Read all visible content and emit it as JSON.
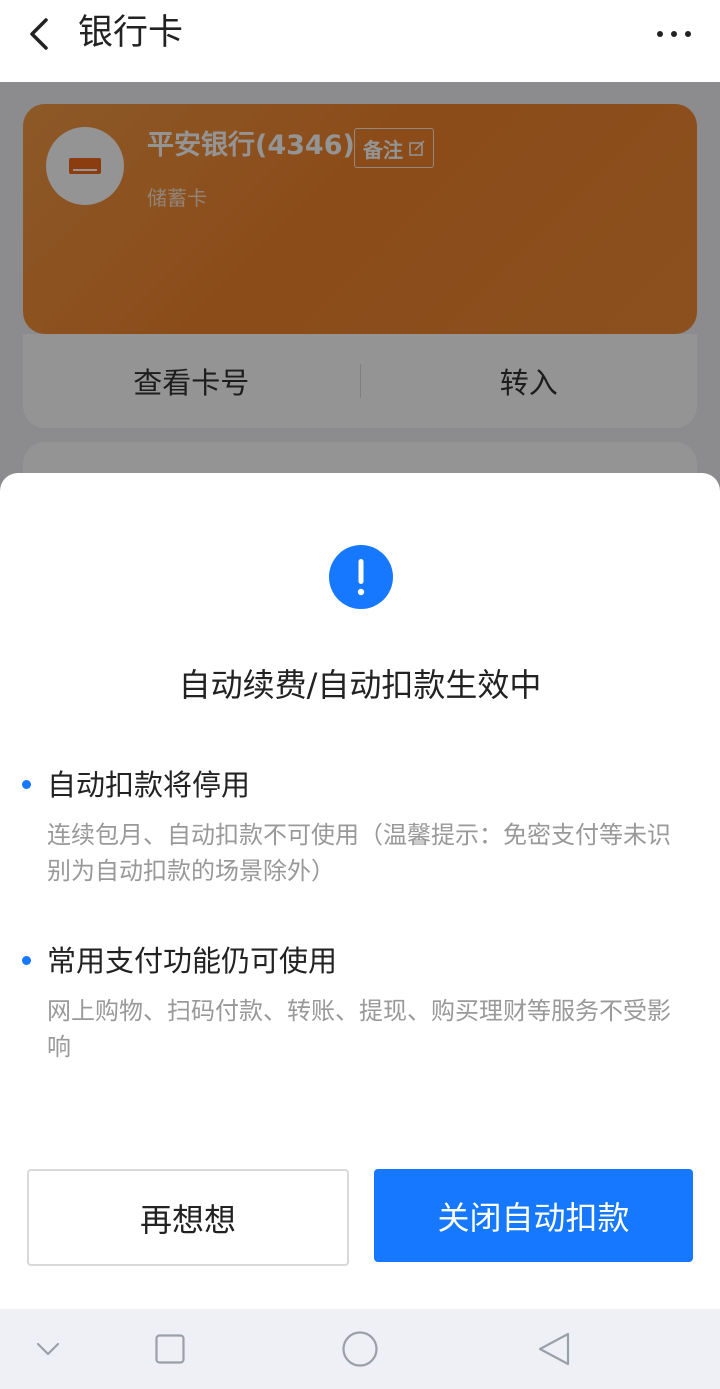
{
  "header": {
    "title": "银行卡",
    "back_icon": "chevron-left-icon",
    "more_icon": "more-dots-icon"
  },
  "card": {
    "bank_name": "平安银行(4346)",
    "note_label": "备注",
    "card_type": "储蓄卡",
    "actions": [
      "查看卡号",
      "转入"
    ],
    "accent_color": "#f08b35"
  },
  "dialog": {
    "icon": "exclamation-icon",
    "title": "自动续费/自动扣款生效中",
    "points": [
      {
        "title": "自动扣款将停用",
        "desc": "连续包月、自动扣款不可使用（温馨提示：免密支付等未识别为自动扣款的场景除外）"
      },
      {
        "title": "常用支付功能仍可使用",
        "desc": "网上购物、扫码付款、转账、提现、购买理财等服务不受影响"
      }
    ],
    "cancel_label": "再想想",
    "confirm_label": "关闭自动扣款",
    "accent_color": "#1677ff"
  },
  "navbar": {
    "icons": [
      "collapse-down-icon",
      "recent-apps-square-icon",
      "home-circle-icon",
      "back-triangle-icon"
    ]
  }
}
